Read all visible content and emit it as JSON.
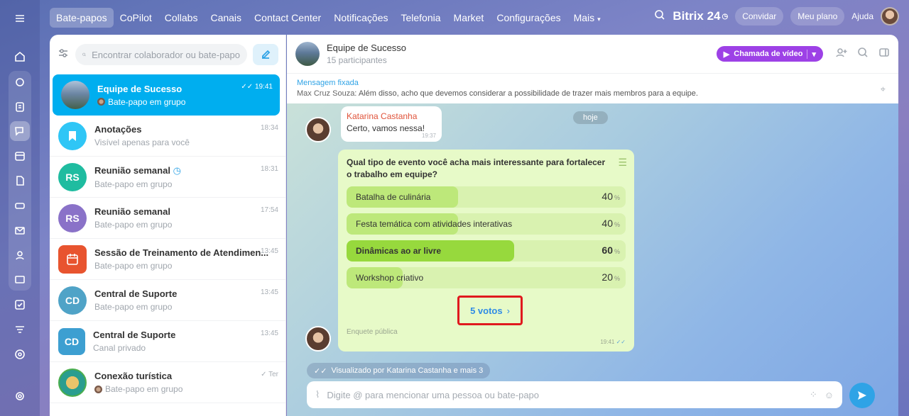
{
  "colors": {
    "accent": "#00aeef",
    "video_button": "#9d41e6",
    "poll_bg": "#e7fac8",
    "highlight": "#e0191e"
  },
  "topnav": {
    "items": [
      "Bate-papos",
      "CoPilot",
      "Collabs",
      "Canais",
      "Contact Center",
      "Notificações",
      "Telefonia",
      "Market",
      "Configurações",
      "Mais"
    ],
    "brand": "Bitrix 24",
    "invite": "Convidar",
    "plan": "Meu plano",
    "help": "Ajuda"
  },
  "sidebar": {
    "search_placeholder": "Encontrar colaborador ou bate-papo",
    "chats": [
      {
        "name": "Equipe de Sucesso",
        "sub": "Bate-papo em grupo",
        "time": "19:41",
        "initials": ""
      },
      {
        "name": "Anotações",
        "sub": "Visível apenas para você",
        "time": "18:34",
        "initials": ""
      },
      {
        "name": "Reunião semanal",
        "sub": "Bate-papo em grupo",
        "time": "18:31",
        "initials": "RS"
      },
      {
        "name": "Reunião semanal",
        "sub": "Bate-papo em grupo",
        "time": "17:54",
        "initials": "RS"
      },
      {
        "name": "Sessão de Treinamento de Atendimen...",
        "sub": "Bate-papo em grupo",
        "time": "13:45",
        "initials": ""
      },
      {
        "name": "Central de Suporte",
        "sub": "Bate-papo em grupo",
        "time": "13:45",
        "initials": "CD"
      },
      {
        "name": "Central de Suporte",
        "sub": "Canal privado",
        "time": "13:45",
        "initials": "CD"
      },
      {
        "name": "Conexão turística",
        "sub": "Bate-papo em grupo",
        "time": "Ter",
        "initials": ""
      }
    ]
  },
  "header": {
    "title": "Equipe de Sucesso",
    "subtitle": "15 participantes",
    "video_call": "Chamada de vídeo"
  },
  "pinned": {
    "title": "Mensagem fixada",
    "author": "Max Cruz Souza:",
    "text": "Além disso, acho que devemos considerar a possibilidade de trazer mais membros para a equipe."
  },
  "chat": {
    "date": "hoje",
    "message": {
      "author": "Katarina Castanha",
      "text": "Certo, vamos nessa!",
      "time": "19:37"
    },
    "poll": {
      "question": "Qual tipo de evento você acha mais interessante para fortalecer o trabalho em equipe?",
      "options": [
        {
          "label": "Batalha de culinária",
          "percent": 40
        },
        {
          "label": "Festa temática com atividades interativas",
          "percent": 40
        },
        {
          "label": "Dinâmicas ao ar livre",
          "percent": 60
        },
        {
          "label": "Workshop criativo",
          "percent": 20
        }
      ],
      "percent_sign": "%",
      "votes": "5 votos",
      "footer": "Enquete pública",
      "time": "19:41"
    },
    "seen": "Visualizado por Katarina Castanha e mais 3",
    "input_placeholder": "Digite @ para mencionar uma pessoa ou bate-papo"
  }
}
